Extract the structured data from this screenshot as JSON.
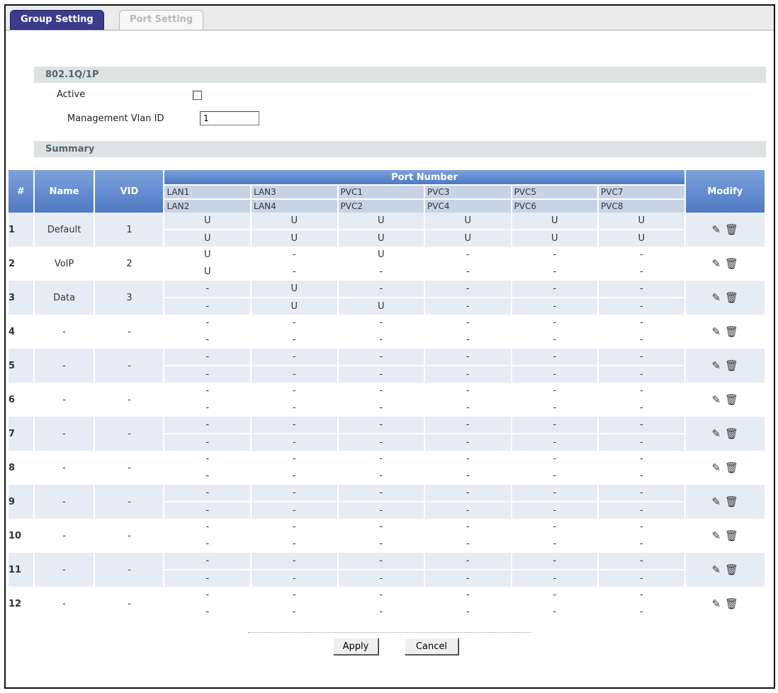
{
  "tabs": {
    "group": "Group Setting",
    "port": "Port Setting"
  },
  "section_8021q": "802.1Q/1P",
  "active_label": "Active",
  "mgmt_label": "Management Vlan ID",
  "mgmt_value": "1",
  "section_summary": "Summary",
  "table": {
    "h_num": "#",
    "h_name": "Name",
    "h_vid": "VID",
    "h_port": "Port Number",
    "h_modify": "Modify",
    "ports_top": [
      "LAN1",
      "LAN3",
      "PVC1",
      "PVC3",
      "PVC5",
      "PVC7"
    ],
    "ports_bot": [
      "LAN2",
      "LAN4",
      "PVC2",
      "PVC4",
      "PVC6",
      "PVC8"
    ],
    "rows": [
      {
        "num": "1",
        "name": "Default",
        "vid": "1",
        "top": [
          "U",
          "U",
          "U",
          "U",
          "U",
          "U"
        ],
        "bot": [
          "U",
          "U",
          "U",
          "U",
          "U",
          "U"
        ]
      },
      {
        "num": "2",
        "name": "VoIP",
        "vid": "2",
        "top": [
          "U",
          "-",
          "U",
          "-",
          "-",
          "-"
        ],
        "bot": [
          "U",
          "-",
          "-",
          "-",
          "-",
          "-"
        ]
      },
      {
        "num": "3",
        "name": "Data",
        "vid": "3",
        "top": [
          "-",
          "U",
          "-",
          "-",
          "-",
          "-"
        ],
        "bot": [
          "-",
          "U",
          "U",
          "-",
          "-",
          "-"
        ]
      },
      {
        "num": "4",
        "name": "-",
        "vid": "-",
        "top": [
          "-",
          "-",
          "-",
          "-",
          "-",
          "-"
        ],
        "bot": [
          "-",
          "-",
          "-",
          "-",
          "-",
          "-"
        ]
      },
      {
        "num": "5",
        "name": "-",
        "vid": "-",
        "top": [
          "-",
          "-",
          "-",
          "-",
          "-",
          "-"
        ],
        "bot": [
          "-",
          "-",
          "-",
          "-",
          "-",
          "-"
        ]
      },
      {
        "num": "6",
        "name": "-",
        "vid": "-",
        "top": [
          "-",
          "-",
          "-",
          "-",
          "-",
          "-"
        ],
        "bot": [
          "-",
          "-",
          "-",
          "-",
          "-",
          "-"
        ]
      },
      {
        "num": "7",
        "name": "-",
        "vid": "-",
        "top": [
          "-",
          "-",
          "-",
          "-",
          "-",
          "-"
        ],
        "bot": [
          "-",
          "-",
          "-",
          "-",
          "-",
          "-"
        ]
      },
      {
        "num": "8",
        "name": "-",
        "vid": "-",
        "top": [
          "-",
          "-",
          "-",
          "-",
          "-",
          "-"
        ],
        "bot": [
          "-",
          "-",
          "-",
          "-",
          "-",
          "-"
        ]
      },
      {
        "num": "9",
        "name": "-",
        "vid": "-",
        "top": [
          "-",
          "-",
          "-",
          "-",
          "-",
          "-"
        ],
        "bot": [
          "-",
          "-",
          "-",
          "-",
          "-",
          "-"
        ]
      },
      {
        "num": "10",
        "name": "-",
        "vid": "-",
        "top": [
          "-",
          "-",
          "-",
          "-",
          "-",
          "-"
        ],
        "bot": [
          "-",
          "-",
          "-",
          "-",
          "-",
          "-"
        ]
      },
      {
        "num": "11",
        "name": "-",
        "vid": "-",
        "top": [
          "-",
          "-",
          "-",
          "-",
          "-",
          "-"
        ],
        "bot": [
          "-",
          "-",
          "-",
          "-",
          "-",
          "-"
        ]
      },
      {
        "num": "12",
        "name": "-",
        "vid": "-",
        "top": [
          "-",
          "-",
          "-",
          "-",
          "-",
          "-"
        ],
        "bot": [
          "-",
          "-",
          "-",
          "-",
          "-",
          "-"
        ]
      }
    ],
    "edit_icon": "edit-icon",
    "delete_icon": "trash-icon"
  },
  "buttons": {
    "apply": "Apply",
    "cancel": "Cancel"
  }
}
